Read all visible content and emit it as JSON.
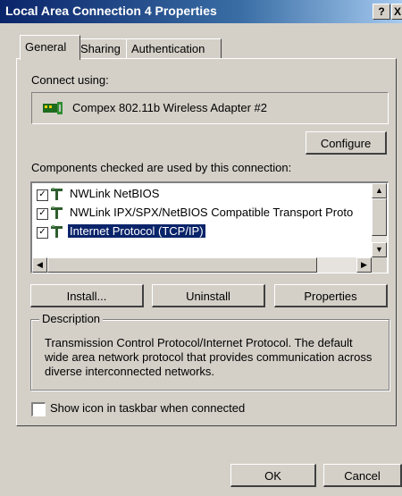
{
  "window": {
    "title": "Local Area Connection 4 Properties",
    "help_label": "?",
    "close_label": "X"
  },
  "tabs": [
    {
      "label": "General",
      "active": true
    },
    {
      "label": "Sharing",
      "active": false
    },
    {
      "label": "Authentication",
      "active": false
    }
  ],
  "general": {
    "connect_using_label": "Connect using:",
    "adapter_name": "Compex 802.11b Wireless Adapter #2",
    "configure_label": "Configure",
    "components_label": "Components checked are used by this connection:",
    "components": [
      {
        "label": "NWLink NetBIOS",
        "checked": true,
        "selected": false,
        "icon": "network-protocol-icon"
      },
      {
        "label": "NWLink IPX/SPX/NetBIOS Compatible Transport Proto",
        "checked": true,
        "selected": false,
        "icon": "network-protocol-icon"
      },
      {
        "label": "Internet Protocol (TCP/IP)",
        "checked": true,
        "selected": true,
        "icon": "network-protocol-icon"
      }
    ],
    "install_label": "Install...",
    "uninstall_label": "Uninstall",
    "properties_label": "Properties",
    "description_title": "Description",
    "description_text": "Transmission Control Protocol/Internet Protocol. The default wide area network protocol that provides communication across diverse interconnected networks.",
    "show_icon_label": "Show icon in taskbar when connected",
    "show_icon_checked": false
  },
  "footer": {
    "ok_label": "OK",
    "cancel_label": "Cancel"
  },
  "colors": {
    "face": "#d4d0c8",
    "title_active": "#0a246a",
    "selection": "#0a246a"
  }
}
